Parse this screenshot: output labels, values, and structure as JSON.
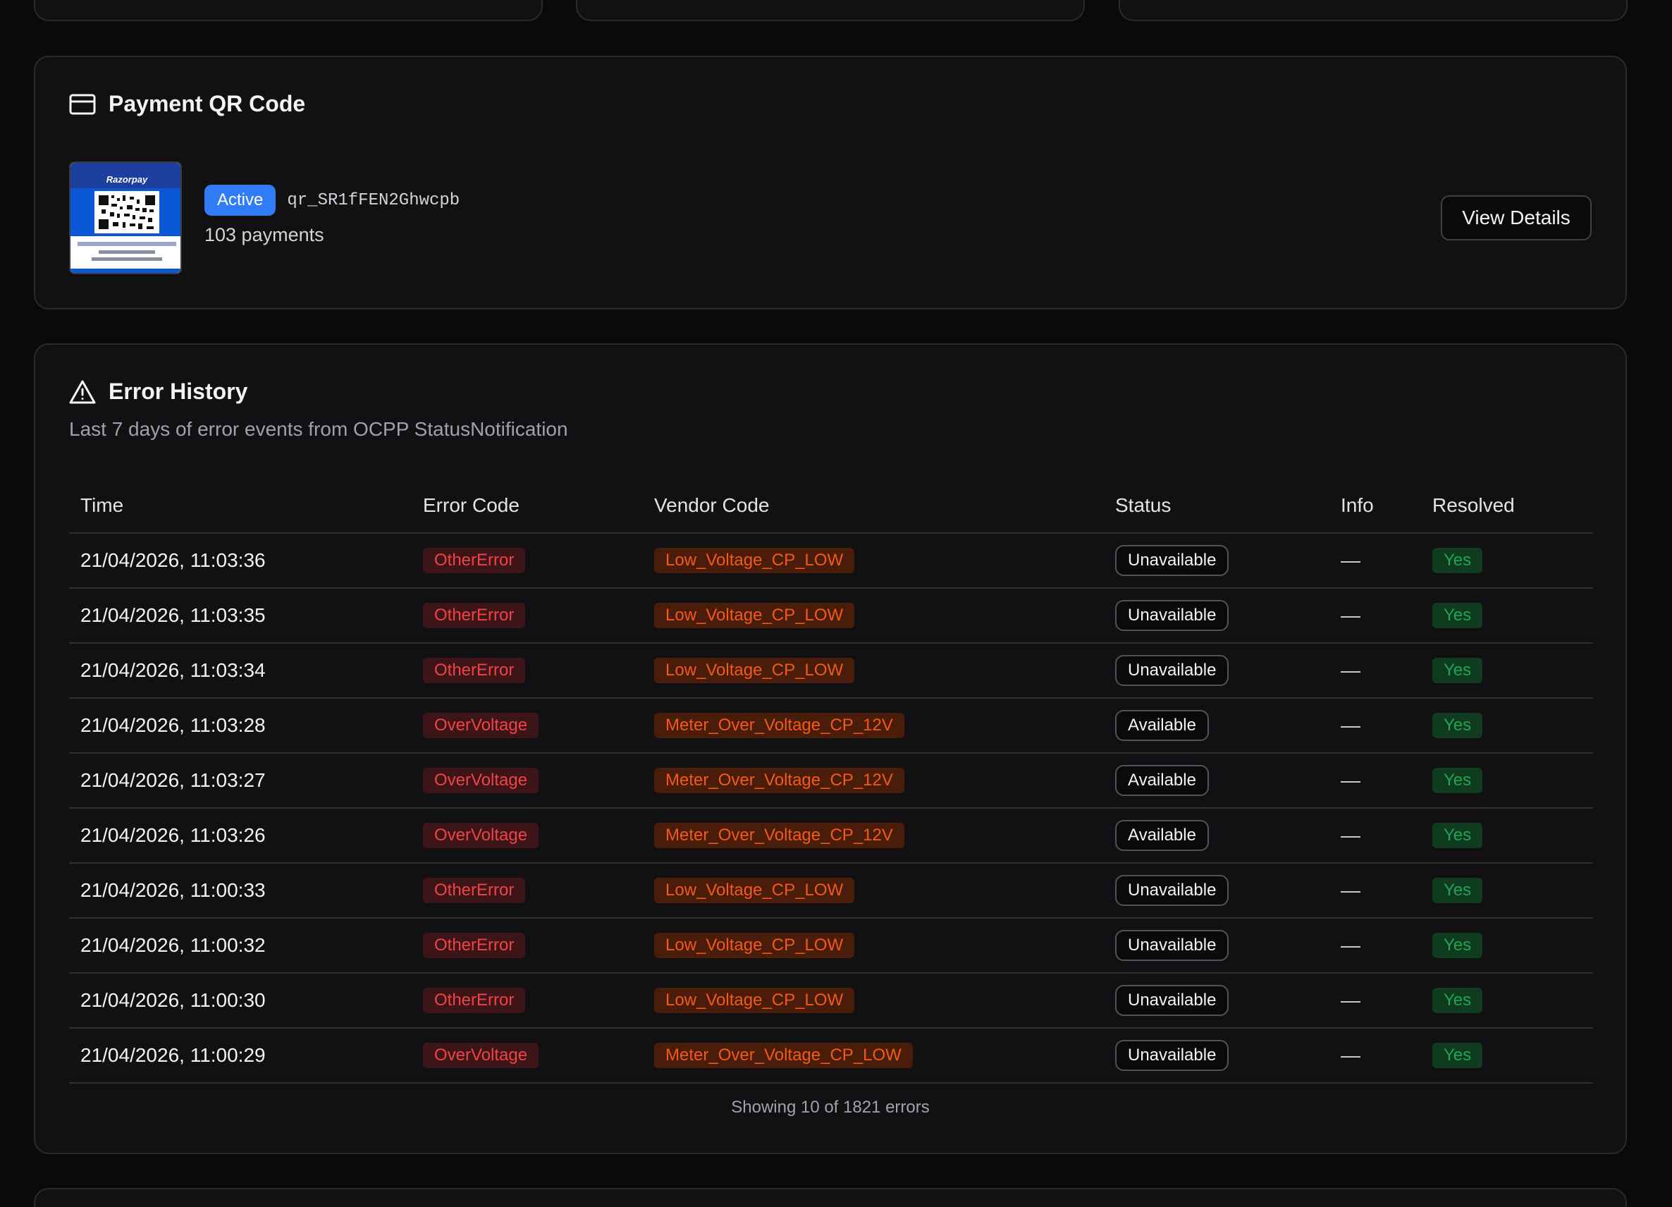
{
  "payment_qr": {
    "title": "Payment QR Code",
    "status": "Active",
    "qr_id": "qr_SR1fFEN2Ghwcpb",
    "payments": "103 payments",
    "view_details": "View Details",
    "thumbnail_brand": "Razorpay"
  },
  "error_history": {
    "title": "Error History",
    "subtitle": "Last 7 days of error events from OCPP StatusNotification",
    "columns": {
      "time": "Time",
      "error_code": "Error Code",
      "vendor_code": "Vendor Code",
      "status": "Status",
      "info": "Info",
      "resolved": "Resolved"
    },
    "rows": [
      {
        "time": "21/04/2026, 11:03:36",
        "error_code": "OtherError",
        "vendor_code": "Low_Voltage_CP_LOW",
        "status": "Unavailable",
        "info": "—",
        "resolved": "Yes"
      },
      {
        "time": "21/04/2026, 11:03:35",
        "error_code": "OtherError",
        "vendor_code": "Low_Voltage_CP_LOW",
        "status": "Unavailable",
        "info": "—",
        "resolved": "Yes"
      },
      {
        "time": "21/04/2026, 11:03:34",
        "error_code": "OtherError",
        "vendor_code": "Low_Voltage_CP_LOW",
        "status": "Unavailable",
        "info": "—",
        "resolved": "Yes"
      },
      {
        "time": "21/04/2026, 11:03:28",
        "error_code": "OverVoltage",
        "vendor_code": "Meter_Over_Voltage_CP_12V",
        "status": "Available",
        "info": "—",
        "resolved": "Yes"
      },
      {
        "time": "21/04/2026, 11:03:27",
        "error_code": "OverVoltage",
        "vendor_code": "Meter_Over_Voltage_CP_12V",
        "status": "Available",
        "info": "—",
        "resolved": "Yes"
      },
      {
        "time": "21/04/2026, 11:03:26",
        "error_code": "OverVoltage",
        "vendor_code": "Meter_Over_Voltage_CP_12V",
        "status": "Available",
        "info": "—",
        "resolved": "Yes"
      },
      {
        "time": "21/04/2026, 11:00:33",
        "error_code": "OtherError",
        "vendor_code": "Low_Voltage_CP_LOW",
        "status": "Unavailable",
        "info": "—",
        "resolved": "Yes"
      },
      {
        "time": "21/04/2026, 11:00:32",
        "error_code": "OtherError",
        "vendor_code": "Low_Voltage_CP_LOW",
        "status": "Unavailable",
        "info": "—",
        "resolved": "Yes"
      },
      {
        "time": "21/04/2026, 11:00:30",
        "error_code": "OtherError",
        "vendor_code": "Low_Voltage_CP_LOW",
        "status": "Unavailable",
        "info": "—",
        "resolved": "Yes"
      },
      {
        "time": "21/04/2026, 11:00:29",
        "error_code": "OverVoltage",
        "vendor_code": "Meter_Over_Voltage_CP_LOW",
        "status": "Unavailable",
        "info": "—",
        "resolved": "Yes"
      }
    ],
    "footer": "Showing 10 of 1821 errors"
  },
  "icons": {
    "payment": "credit-card-icon",
    "error": "alert-triangle-icon"
  },
  "colors": {
    "background": "#0a0a0b",
    "card": "#111113",
    "accent_blue": "#2f7cf6",
    "error_red": "#ef4444",
    "vendor_orange": "#f25a1a",
    "resolved_green": "#22a355"
  }
}
